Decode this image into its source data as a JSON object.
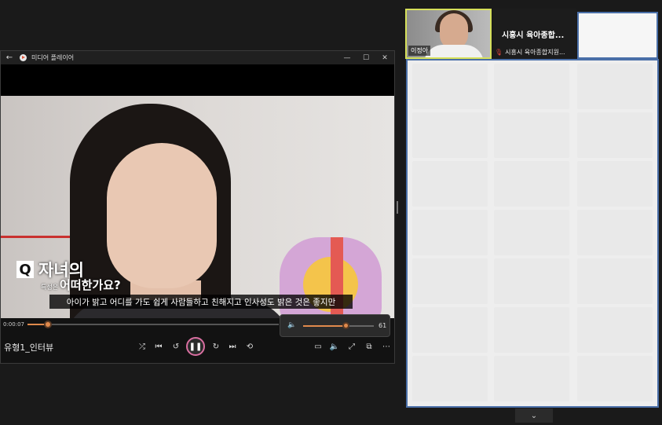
{
  "player": {
    "title": "미디어 플레이어",
    "back_glyph": "←",
    "minimize_glyph": "—",
    "maximize_glyph": "☐",
    "close_glyph": "✕",
    "current_time": "0:00:07",
    "progress_fraction": 0.08,
    "track_name": "유형1_인터뷰",
    "volume": "61",
    "volume_fraction": 0.61,
    "accent_color": "#e08a4c"
  },
  "video_overlay": {
    "q_badge": "Q",
    "q_title": "자녀의",
    "q_small": "특성은",
    "q_subtitle": "어떠한가요?",
    "caption": "아이가 밝고 어디를 가도 쉽게 사람들하고 친해지고 인사성도 밝은 것은 좋지만"
  },
  "zoom": {
    "self_name": "이정아",
    "center_title": "시흥시 육아종합...",
    "center_sub": "시흥시 육아종합지원...",
    "selection_color": "#4a6fa8",
    "pager_glyph": "⌄"
  }
}
